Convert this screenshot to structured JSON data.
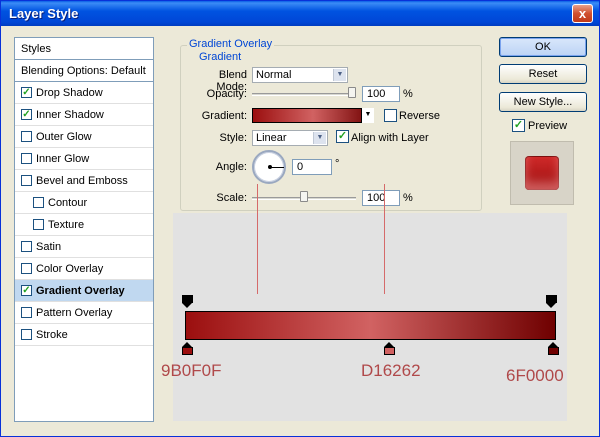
{
  "window": {
    "title": "Layer Style",
    "close_glyph": "x"
  },
  "styles_list": {
    "header": "Styles",
    "items": [
      {
        "label": "Blending Options: Default",
        "checkbox": false,
        "checked": false
      },
      {
        "label": "Drop Shadow",
        "checkbox": true,
        "checked": true
      },
      {
        "label": "Inner Shadow",
        "checkbox": true,
        "checked": true
      },
      {
        "label": "Outer Glow",
        "checkbox": true,
        "checked": false
      },
      {
        "label": "Inner Glow",
        "checkbox": true,
        "checked": false
      },
      {
        "label": "Bevel and Emboss",
        "checkbox": true,
        "checked": false
      },
      {
        "label": "Contour",
        "checkbox": true,
        "checked": false,
        "indent": true
      },
      {
        "label": "Texture",
        "checkbox": true,
        "checked": false,
        "indent": true
      },
      {
        "label": "Satin",
        "checkbox": true,
        "checked": false
      },
      {
        "label": "Color Overlay",
        "checkbox": true,
        "checked": false
      },
      {
        "label": "Gradient Overlay",
        "checkbox": true,
        "checked": true,
        "selected": true
      },
      {
        "label": "Pattern Overlay",
        "checkbox": true,
        "checked": false
      },
      {
        "label": "Stroke",
        "checkbox": true,
        "checked": false
      }
    ]
  },
  "panel": {
    "title": "Gradient Overlay",
    "subtitle": "Gradient",
    "blend_mode_label": "Blend Mode:",
    "blend_mode_value": "Normal",
    "opacity_label": "Opacity:",
    "opacity_value": "100",
    "opacity_unit": "%",
    "opacity_level": 1.0,
    "gradient_label": "Gradient:",
    "reverse_label": "Reverse",
    "reverse_checked": false,
    "style_label": "Style:",
    "style_value": "Linear",
    "align_label": "Align with Layer",
    "align_checked": true,
    "angle_label": "Angle:",
    "angle_value": "0",
    "angle_unit": "°",
    "scale_label": "Scale:",
    "scale_value": "100",
    "scale_unit": "%",
    "scale_level": 0.5
  },
  "buttons": {
    "ok": "OK",
    "reset": "Reset",
    "new_style": "New Style...",
    "preview_label": "Preview",
    "preview_checked": true
  },
  "gradient_stops": [
    {
      "hex": "9B0F0F",
      "color": "#9B0F0F",
      "location": 0
    },
    {
      "hex": "D16262",
      "color": "#D16262",
      "location": 0.55
    },
    {
      "hex": "6F0000",
      "color": "#6F0000",
      "location": 1
    }
  ],
  "colors": {
    "accent": "#0046d5",
    "label_red": "#b0494a",
    "title_blue": "#0053e1"
  }
}
